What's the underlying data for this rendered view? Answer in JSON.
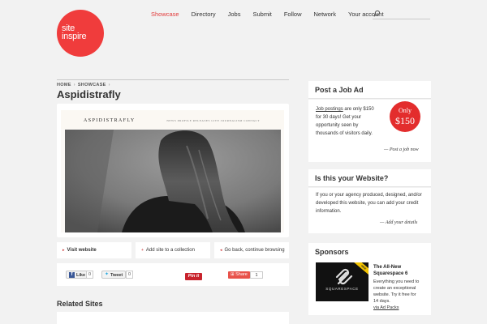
{
  "logo": {
    "line1": "site",
    "line2": "inspire"
  },
  "nav": [
    {
      "label": "Showcase"
    },
    {
      "label": "Directory"
    },
    {
      "label": "Jobs"
    },
    {
      "label": "Submit"
    },
    {
      "label": "Follow"
    },
    {
      "label": "Network"
    },
    {
      "label": "Your account"
    }
  ],
  "breadcrumb": {
    "home": "HOME",
    "showcase": "SHOWCASE"
  },
  "page_title": "Aspidistrafly",
  "preview": {
    "site_logo": "ASPIDISTRAFLY",
    "site_menu": "NEWS   PROFILE   RELEASES   LIVE   JOURNALISM   CONTACT"
  },
  "actions": {
    "visit": "Visit website",
    "add": "Add site to a collection",
    "back": "Go back, continue browsing"
  },
  "social": {
    "like_label": "Like",
    "like_count": "0",
    "tweet_label": "Tweet",
    "tweet_count": "0",
    "pin_label": "Pin it",
    "share_label": "Share",
    "share_count": "1"
  },
  "related": {
    "title": "Related Sites"
  },
  "job_ad": {
    "title": "Post a Job Ad",
    "link_text": "Job postings",
    "line1_rest": " are only $150",
    "line2": "for 30 days! Get your",
    "line3": "opportunity seen by",
    "line4": "thousands of visitors daily.",
    "badge_top": "Only",
    "badge_price": "$150",
    "cta": "— Post a job now"
  },
  "your_site": {
    "title": "Is this your Website?",
    "line1": "If you or your agency produced, designed, and/or",
    "line2": "developed this website, you can add your credit",
    "line3": "information.",
    "cta": "— Add your details"
  },
  "sponsors": {
    "title": "Sponsors",
    "ad_logo_text": "SQUARESPACE",
    "ad_corner": "NEW",
    "ad_title_1": "The All-New",
    "ad_title_2": "Squarespace 6",
    "ad_body_1": "Everything you need to",
    "ad_body_2": "create an exceptional",
    "ad_body_3": "website. Try it free for",
    "ad_body_4": "14 days.",
    "via": "via Ad Packs"
  },
  "colors": {
    "brand_red": "#f03c3c",
    "nav_active": "#e23b3b",
    "page_bg": "#f2f2f2"
  }
}
